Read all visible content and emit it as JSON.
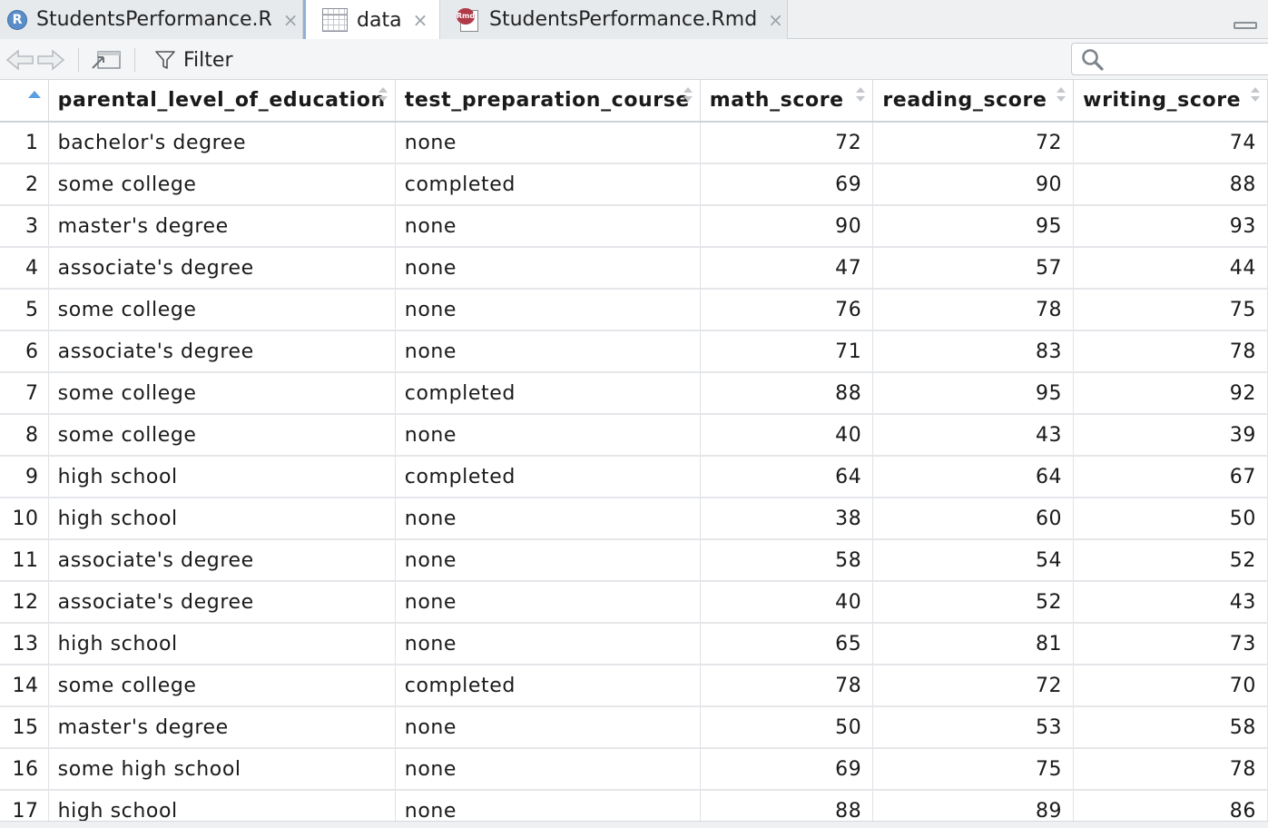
{
  "tabs": [
    {
      "label": "StudentsPerformance.R",
      "icon": "r-script-icon",
      "active": false
    },
    {
      "label": "data",
      "icon": "data-grid-icon",
      "active": true
    },
    {
      "label": "StudentsPerformance.Rmd",
      "icon": "rmarkdown-icon",
      "active": false
    }
  ],
  "icons": {
    "r_badge": "R",
    "rmd_badge": "Rmd",
    "close": "×"
  },
  "toolbar": {
    "filter_label": "Filter",
    "search_placeholder": ""
  },
  "table": {
    "columns": [
      "parental_level_of_education",
      "test_preparation_course",
      "math_score",
      "reading_score",
      "writing_score"
    ],
    "rows": [
      {
        "n": "1",
        "edu": "bachelor's degree",
        "prep": "none",
        "math": "72",
        "reading": "72",
        "writing": "74"
      },
      {
        "n": "2",
        "edu": "some college",
        "prep": "completed",
        "math": "69",
        "reading": "90",
        "writing": "88"
      },
      {
        "n": "3",
        "edu": "master's degree",
        "prep": "none",
        "math": "90",
        "reading": "95",
        "writing": "93"
      },
      {
        "n": "4",
        "edu": "associate's degree",
        "prep": "none",
        "math": "47",
        "reading": "57",
        "writing": "44"
      },
      {
        "n": "5",
        "edu": "some college",
        "prep": "none",
        "math": "76",
        "reading": "78",
        "writing": "75"
      },
      {
        "n": "6",
        "edu": "associate's degree",
        "prep": "none",
        "math": "71",
        "reading": "83",
        "writing": "78"
      },
      {
        "n": "7",
        "edu": "some college",
        "prep": "completed",
        "math": "88",
        "reading": "95",
        "writing": "92"
      },
      {
        "n": "8",
        "edu": "some college",
        "prep": "none",
        "math": "40",
        "reading": "43",
        "writing": "39"
      },
      {
        "n": "9",
        "edu": "high school",
        "prep": "completed",
        "math": "64",
        "reading": "64",
        "writing": "67"
      },
      {
        "n": "10",
        "edu": "high school",
        "prep": "none",
        "math": "38",
        "reading": "60",
        "writing": "50"
      },
      {
        "n": "11",
        "edu": "associate's degree",
        "prep": "none",
        "math": "58",
        "reading": "54",
        "writing": "52"
      },
      {
        "n": "12",
        "edu": "associate's degree",
        "prep": "none",
        "math": "40",
        "reading": "52",
        "writing": "43"
      },
      {
        "n": "13",
        "edu": "high school",
        "prep": "none",
        "math": "65",
        "reading": "81",
        "writing": "73"
      },
      {
        "n": "14",
        "edu": "some college",
        "prep": "completed",
        "math": "78",
        "reading": "72",
        "writing": "70"
      },
      {
        "n": "15",
        "edu": "master's degree",
        "prep": "none",
        "math": "50",
        "reading": "53",
        "writing": "58"
      },
      {
        "n": "16",
        "edu": "some high school",
        "prep": "none",
        "math": "69",
        "reading": "75",
        "writing": "78"
      },
      {
        "n": "17",
        "edu": "high school",
        "prep": "none",
        "math": "88",
        "reading": "89",
        "writing": "86"
      }
    ]
  },
  "colors": {
    "accent": "#5b9fe0",
    "tab_active_border": "#8fb0d6",
    "rmd_badge": "#b03a48",
    "r_badge": "#5b8ec9"
  }
}
